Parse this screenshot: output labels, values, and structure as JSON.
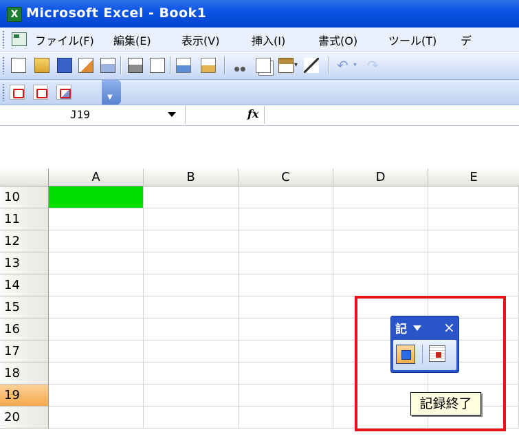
{
  "window": {
    "title": "Microsoft Excel - Book1",
    "app_icon": "excel-icon"
  },
  "menu": {
    "items": [
      "ファイル(F)",
      "編集(E)",
      "表示(V)",
      "挿入(I)",
      "書式(O)",
      "ツール(T)",
      "デ"
    ]
  },
  "toolbar_standard": {
    "icons": [
      "new-icon",
      "open-icon",
      "save-icon",
      "permission-icon",
      "email-icon",
      "print-icon",
      "print-preview-icon",
      "spelling-icon",
      "research-icon",
      "cut-icon",
      "copy-icon",
      "paste-icon",
      "format-painter-icon",
      "undo-icon",
      "redo-icon"
    ]
  },
  "toolbar_pdf": {
    "icons": [
      "pdf-convert-icon",
      "pdf-email-icon",
      "pdf-review-icon"
    ]
  },
  "formula_bar": {
    "name_box": "J19",
    "fx_label": "fx",
    "formula": ""
  },
  "grid": {
    "columns": [
      "A",
      "B",
      "C",
      "D",
      "E"
    ],
    "rows": [
      "10",
      "11",
      "12",
      "13",
      "14",
      "15",
      "16",
      "17",
      "18",
      "19",
      "20"
    ],
    "active_row": "19",
    "filled_cell": {
      "column": "A",
      "row": "10",
      "color": "#00e000"
    }
  },
  "stop_recording_toolbar": {
    "title": "記",
    "stop_icon": "stop-recording-icon",
    "relative_icon": "relative-reference-icon"
  },
  "tooltip": {
    "text": "記録終了"
  },
  "colors": {
    "highlight_box": "#e8121a",
    "title_bar": "#0a55e6"
  }
}
